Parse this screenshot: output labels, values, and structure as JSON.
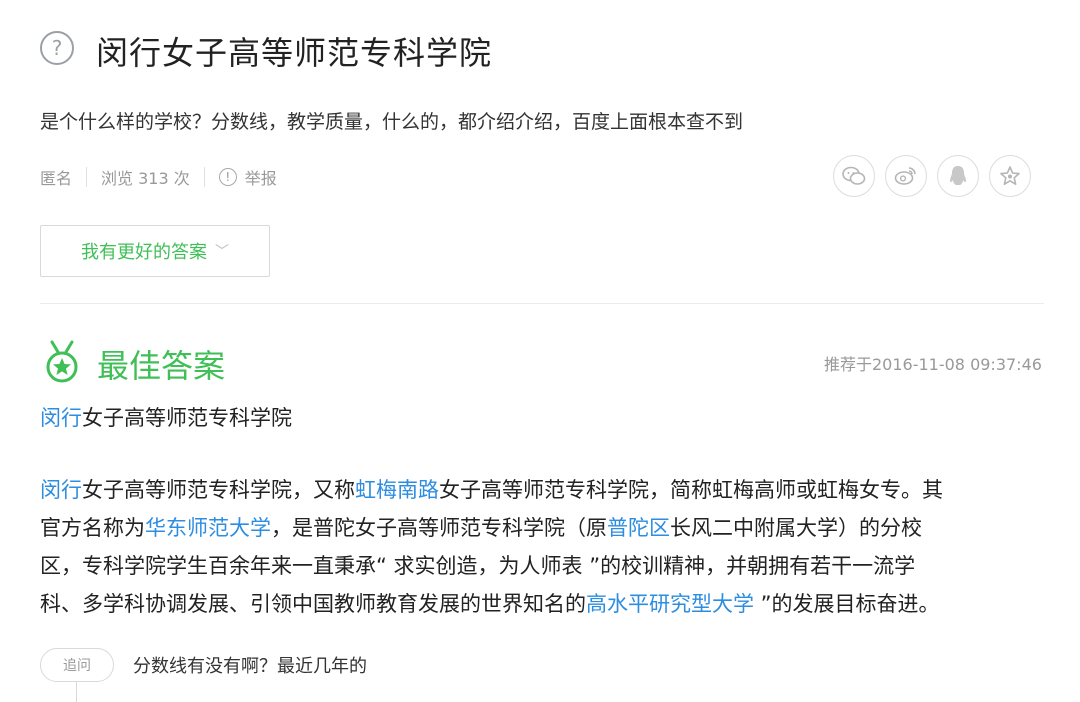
{
  "question": {
    "title": "闵行女子高等师范专科学院",
    "description": "是个什么样的学校？分数线，教学质量，什么的，都介绍介绍，百度上面根本查不到",
    "meta": {
      "author": "匿名",
      "views": "浏览 313 次",
      "report": "举报"
    },
    "share_icons": [
      "wechat-icon",
      "weibo-icon",
      "qq-icon",
      "favorite-star-icon"
    ],
    "better_answer_button": "我有更好的答案"
  },
  "best_answer": {
    "heading": "最佳答案",
    "timestamp": "推荐于2016-11-08 09:37:46",
    "title_link": "闵行",
    "title_rest": "女子高等师范专科学院",
    "paragraph": {
      "l1_a": "闵行",
      "l1_b": "女子高等师范专科学院，又称",
      "l1_c": "虹梅南路",
      "l1_d": "女子高等师范专科学院，简称虹梅高师或虹梅女专。其",
      "l2_a": "官方名称为",
      "l2_b": "华东师范大学",
      "l2_c": "，是普陀女子高等师范专科学院（原",
      "l2_d": "普陀区",
      "l2_e": "长风二中附属大学）的分校",
      "l3": "区，专科学院学生百余年来一直秉承“ 求实创造，为人师表 ”的校训精神，并朝拥有若干一流学",
      "l4_a": "科、多学科协调发展、引领中国教师教育发展的世界知名的",
      "l4_b": "高水平研究型大学",
      "l4_c": " ”的发展目标奋进。"
    }
  },
  "follow_up": {
    "tag": "追问",
    "text": "分数线有没有啊？最近几年的"
  },
  "colors": {
    "accent_green": "#3fbf56",
    "link_blue": "#2d8de0"
  }
}
